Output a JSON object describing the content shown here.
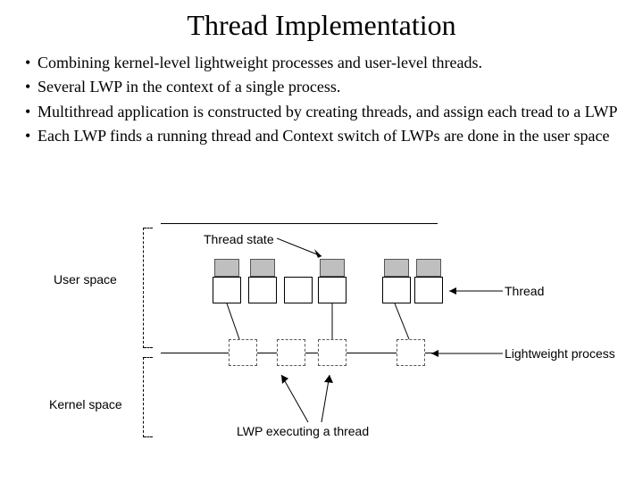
{
  "title": "Thread Implementation",
  "bullets": [
    "Combining kernel-level lightweight processes and user-level threads.",
    "Several LWP in the context of a single process.",
    "Multithread application is constructed by creating threads, and assign each tread to a LWP",
    "Each LWP finds a running thread and Context switch of LWPs are done in the user space"
  ],
  "diagram": {
    "labels": {
      "thread_state": "Thread state",
      "user_space": "User space",
      "thread": "Thread",
      "kernel_space": "Kernel space",
      "lwp": "Lightweight process",
      "lwp_exec": "LWP executing a thread"
    }
  }
}
